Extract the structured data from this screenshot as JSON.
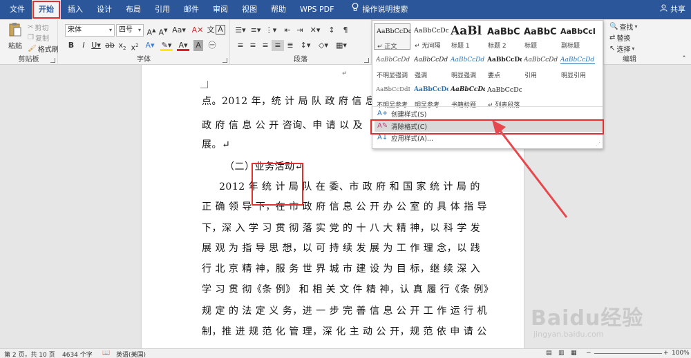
{
  "tabs": [
    "文件",
    "开始",
    "插入",
    "设计",
    "布局",
    "引用",
    "邮件",
    "审阅",
    "视图",
    "帮助",
    "WPS PDF"
  ],
  "active_tab_index": 1,
  "tell_me": "操作说明搜索",
  "share": "共享",
  "clipboard": {
    "paste": "粘贴",
    "cut": "剪切",
    "copy": "复制",
    "format_painter": "格式刷",
    "label": "剪贴板"
  },
  "font": {
    "name": "宋体",
    "size": "四号",
    "label": "字体"
  },
  "paragraph": {
    "label": "段落"
  },
  "editing": {
    "find": "查找",
    "replace": "替换",
    "select": "选择",
    "label": "编辑"
  },
  "styles_panel": {
    "rows": [
      [
        {
          "sample": "AaBbCcDc",
          "name": "↵ 正文"
        },
        {
          "sample": "AaBbCcDc",
          "name": "↵ 无间隔"
        },
        {
          "sample": "AaBl",
          "name": "标题 1"
        },
        {
          "sample": "AaBbC",
          "name": "标题 2"
        },
        {
          "sample": "AaBbC",
          "name": "标题"
        },
        {
          "sample": "AaBbCcD",
          "name": "副标题"
        }
      ],
      [
        {
          "sample": "AaBbCcDd",
          "name": "不明显强调"
        },
        {
          "sample": "AaBbCcDd",
          "name": "强调"
        },
        {
          "sample": "AaBbCcDd",
          "name": "明显强调"
        },
        {
          "sample": "AaBbCcDd",
          "name": "要点"
        },
        {
          "sample": "AaBbCcDd",
          "name": "引用"
        },
        {
          "sample": "AaBbCcDd",
          "name": "明显引用"
        }
      ],
      [
        {
          "sample": "AaBbCcDdI",
          "name": "不明显参考"
        },
        {
          "sample": "AaBbCcDo",
          "name": "明显参考"
        },
        {
          "sample": "AaBbCcDd",
          "name": "书籍标题"
        },
        {
          "sample": "AaBbCcDc",
          "name": "↵ 列表段落"
        }
      ]
    ],
    "create_style": "创建样式(S)",
    "clear_format": "清除格式(C)",
    "apply_style": "应用样式(A)..."
  },
  "document": {
    "lines": [
      "点。2012 年，统 计 局 队 政 府 信 息 公",
      "政 府 信 息 公 开 咨询、申 请 以 及",
      "展。↵",
      "（二）业务活动↵",
      "2012 年  统 计 局 队 在 委、市 政 府 和 国 家 统 计 局 的",
      "正 确 领 导 下，在 市 政 府 信 息 公 开 办 公 室 的 具 体 指 导",
      "下，深 入 学 习 贯 彻  落 实 党 的 十 八 大 精 神，以 科 学 发",
      "展 观 为 指 导 思 想，以 可 持 续 发 展 为 工 作 理 念，以 践",
      "行 北 京 精 神，服 务 世 界 城 市 建 设 为 目 标，继 续 深 入",
      "学 习 贯 彻《条 例》 和 相 关 文 件 精 神，认 真 履 行《条 例》",
      "规 定 的 法 定 义 务，进 一 步 完 善 信 息 公 开 工 作 运 行 机",
      "制，推 进 规 范 化 管 理，深 化 主 动 公 开，规 范 依 申 请 公"
    ]
  },
  "status": {
    "page": "第 2 页，共 10 页",
    "words": "4634 个字",
    "language": "英语(美国)",
    "zoom": "100%"
  },
  "watermark": {
    "brand": "Baidu经验",
    "url": "jingyan.baidu.com"
  }
}
